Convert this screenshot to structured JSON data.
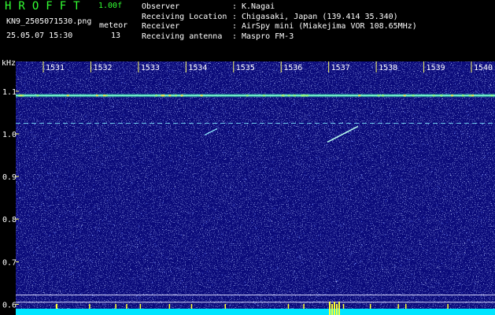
{
  "header": {
    "app_title": "HROFFT",
    "version": "1.00f",
    "filename": "KN9_2505071530.png",
    "mode_label": "meteor",
    "datetime": "25.05.07 15:30",
    "count": "13",
    "sep": ":",
    "info": [
      {
        "key": "Observer",
        "value": "K.Nagai"
      },
      {
        "key": "Receiving Location",
        "value": "Chigasaki, Japan (139.414 35.340)"
      },
      {
        "key": "Receiver",
        "value": "AirSpy mini (Miakejima VOR 108.65MHz)"
      },
      {
        "key": "Receiving antenna",
        "value": "Maspro FM-3"
      }
    ]
  },
  "spectrogram": {
    "y_unit": "kHz",
    "y_ticks": [
      "1.1",
      "1.0",
      "0.9",
      "0.8",
      "0.7",
      "0.6"
    ],
    "y_range": [
      0.575,
      1.17
    ],
    "x_ticks": [
      "1531",
      "1532",
      "1533",
      "1534",
      "1535",
      "1536",
      "1537",
      "1538",
      "1539",
      "1540"
    ],
    "background_color": "#0a0a7a",
    "carrier_freq_khz": 1.09,
    "echo_line_freq_khz": 1.025,
    "colors": {
      "carrier": "#7fffd4",
      "noise": "#6a82ff",
      "baseline": "#00e5ff",
      "peaks": "#ffff33"
    }
  }
}
